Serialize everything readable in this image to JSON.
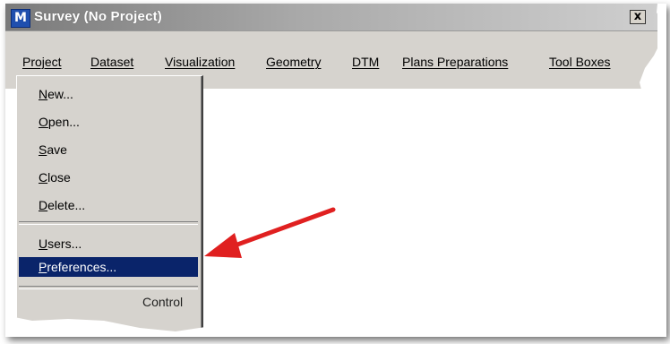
{
  "window": {
    "title": "Survey (No Project)",
    "icon": "survey-app-icon",
    "close_symbol": "x"
  },
  "menubar": {
    "items": [
      {
        "label": "Project"
      },
      {
        "label": "Dataset"
      },
      {
        "label": "Visualization"
      },
      {
        "label": "Geometry"
      },
      {
        "label": "DTM"
      },
      {
        "label": "Plans Preparations"
      },
      {
        "label": "Tool Boxes"
      }
    ]
  },
  "project_menu": {
    "items": [
      {
        "first": "N",
        "rest": "ew..."
      },
      {
        "first": "O",
        "rest": "pen..."
      },
      {
        "first": "S",
        "rest": "ave"
      },
      {
        "first": "C",
        "rest": "lose"
      },
      {
        "first": "D",
        "rest": "elete..."
      },
      {
        "first": "U",
        "rest": "sers..."
      },
      {
        "first": "P",
        "rest": "references..."
      }
    ],
    "selected_label": "Preferences...",
    "partial_item": "Control"
  },
  "colors": {
    "selection": "#0a246a",
    "arrow": "#e02020"
  }
}
